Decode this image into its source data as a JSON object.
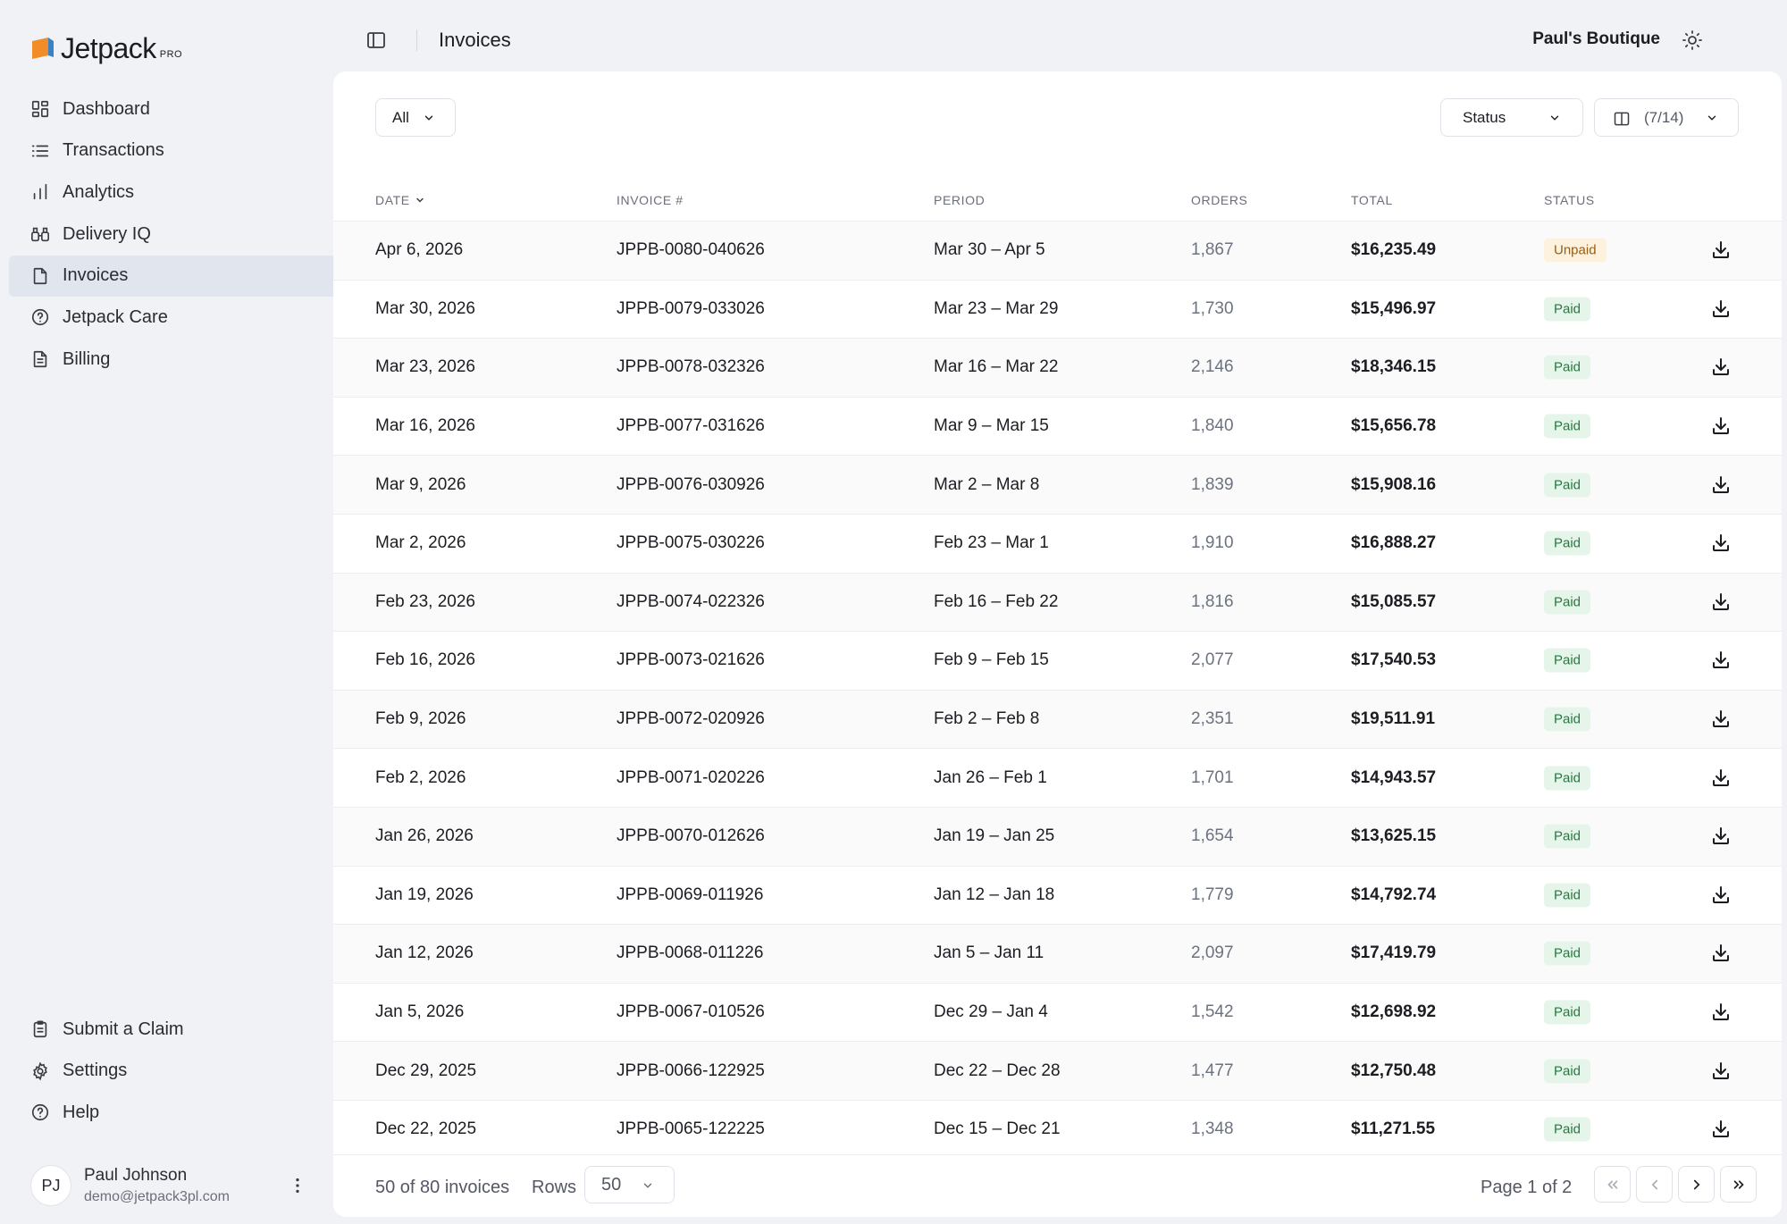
{
  "brand": {
    "name": "Jetpack",
    "tier": "PRO"
  },
  "sidebar": {
    "items": [
      {
        "label": "Dashboard",
        "icon": "dashboard-icon",
        "active": false
      },
      {
        "label": "Transactions",
        "icon": "list-icon",
        "active": false
      },
      {
        "label": "Analytics",
        "icon": "bar-chart-icon",
        "active": false
      },
      {
        "label": "Delivery IQ",
        "icon": "binoculars-icon",
        "active": false
      },
      {
        "label": "Invoices",
        "icon": "file-icon",
        "active": true
      },
      {
        "label": "Jetpack Care",
        "icon": "help-circle-icon",
        "active": false
      },
      {
        "label": "Billing",
        "icon": "receipt-icon",
        "active": false
      }
    ],
    "bottom_items": [
      {
        "label": "Submit a Claim",
        "icon": "clipboard-icon"
      },
      {
        "label": "Settings",
        "icon": "gear-icon"
      },
      {
        "label": "Help",
        "icon": "help-circle-icon"
      }
    ],
    "user": {
      "initials": "PJ",
      "name": "Paul Johnson",
      "email": "demo@jetpack3pl.com"
    }
  },
  "header": {
    "title": "Invoices",
    "store": "Paul's Boutique"
  },
  "filters": {
    "scope": "All",
    "status": "Status",
    "columns": "(7/14)"
  },
  "table": {
    "columns": {
      "date": "DATE",
      "invoice": "INVOICE #",
      "period": "PERIOD",
      "orders": "ORDERS",
      "total": "TOTAL",
      "status": "STATUS"
    },
    "rows": [
      {
        "date": "Apr 6, 2026",
        "invoice": "JPPB-0080-040626",
        "period": "Mar 30 – Apr 5",
        "orders": "1,867",
        "total": "$16,235.49",
        "status": "Unpaid"
      },
      {
        "date": "Mar 30, 2026",
        "invoice": "JPPB-0079-033026",
        "period": "Mar 23 – Mar 29",
        "orders": "1,730",
        "total": "$15,496.97",
        "status": "Paid"
      },
      {
        "date": "Mar 23, 2026",
        "invoice": "JPPB-0078-032326",
        "period": "Mar 16 – Mar 22",
        "orders": "2,146",
        "total": "$18,346.15",
        "status": "Paid"
      },
      {
        "date": "Mar 16, 2026",
        "invoice": "JPPB-0077-031626",
        "period": "Mar 9 – Mar 15",
        "orders": "1,840",
        "total": "$15,656.78",
        "status": "Paid"
      },
      {
        "date": "Mar 9, 2026",
        "invoice": "JPPB-0076-030926",
        "period": "Mar 2 – Mar 8",
        "orders": "1,839",
        "total": "$15,908.16",
        "status": "Paid"
      },
      {
        "date": "Mar 2, 2026",
        "invoice": "JPPB-0075-030226",
        "period": "Feb 23 – Mar 1",
        "orders": "1,910",
        "total": "$16,888.27",
        "status": "Paid"
      },
      {
        "date": "Feb 23, 2026",
        "invoice": "JPPB-0074-022326",
        "period": "Feb 16 – Feb 22",
        "orders": "1,816",
        "total": "$15,085.57",
        "status": "Paid"
      },
      {
        "date": "Feb 16, 2026",
        "invoice": "JPPB-0073-021626",
        "period": "Feb 9 – Feb 15",
        "orders": "2,077",
        "total": "$17,540.53",
        "status": "Paid"
      },
      {
        "date": "Feb 9, 2026",
        "invoice": "JPPB-0072-020926",
        "period": "Feb 2 – Feb 8",
        "orders": "2,351",
        "total": "$19,511.91",
        "status": "Paid"
      },
      {
        "date": "Feb 2, 2026",
        "invoice": "JPPB-0071-020226",
        "period": "Jan 26 – Feb 1",
        "orders": "1,701",
        "total": "$14,943.57",
        "status": "Paid"
      },
      {
        "date": "Jan 26, 2026",
        "invoice": "JPPB-0070-012626",
        "period": "Jan 19 – Jan 25",
        "orders": "1,654",
        "total": "$13,625.15",
        "status": "Paid"
      },
      {
        "date": "Jan 19, 2026",
        "invoice": "JPPB-0069-011926",
        "period": "Jan 12 – Jan 18",
        "orders": "1,779",
        "total": "$14,792.74",
        "status": "Paid"
      },
      {
        "date": "Jan 12, 2026",
        "invoice": "JPPB-0068-011226",
        "period": "Jan 5 – Jan 11",
        "orders": "2,097",
        "total": "$17,419.79",
        "status": "Paid"
      },
      {
        "date": "Jan 5, 2026",
        "invoice": "JPPB-0067-010526",
        "period": "Dec 29 – Jan 4",
        "orders": "1,542",
        "total": "$12,698.92",
        "status": "Paid"
      },
      {
        "date": "Dec 29, 2025",
        "invoice": "JPPB-0066-122925",
        "period": "Dec 22 – Dec 28",
        "orders": "1,477",
        "total": "$12,750.48",
        "status": "Paid"
      },
      {
        "date": "Dec 22, 2025",
        "invoice": "JPPB-0065-122225",
        "period": "Dec 15 – Dec 21",
        "orders": "1,348",
        "total": "$11,271.55",
        "status": "Paid"
      }
    ]
  },
  "footer": {
    "count": "50 of 80 invoices",
    "rows_label": "Rows",
    "rows_value": "50",
    "page": "Page 1 of 2"
  },
  "colors": {
    "accent_active": "#e1e5ee",
    "paid_bg": "#e6f5ea",
    "paid_fg": "#25793f",
    "unpaid_bg": "#fdf2dd",
    "unpaid_fg": "#9a5b12",
    "logo_orange": "#f28c28",
    "logo_blue": "#3b82c4"
  }
}
